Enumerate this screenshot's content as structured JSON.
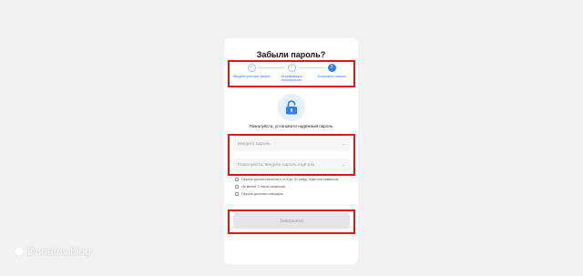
{
  "dialog": {
    "title": "Забыли пароль?",
    "subtitle": "Пожалуйста, установите надёжный пароль"
  },
  "steps": [
    {
      "label": "Введите учётную запись",
      "icon": "check-icon",
      "state": "done"
    },
    {
      "label": "Верификация безопасности",
      "icon": "check-icon",
      "state": "done"
    },
    {
      "label": "Установить пароль",
      "number": "3",
      "state": "active"
    }
  ],
  "fields": {
    "password_placeholder": "Введите пароль",
    "confirm_placeholder": "Пожалуйста, введите пароль ещё раз",
    "visibility_icon": "eye-off-icon"
  },
  "rules": [
    "Пароль должен включать от 8 до 30 цифр, букв или символов",
    "Не менее 2 типов символов",
    "Пароли должны совпадать"
  ],
  "submit_label": "Завершено",
  "watermark": "Donatov.blog",
  "colors": {
    "accent": "#2e7cf6",
    "highlight": "#d7191c",
    "disabled_button": "#e4e5e9"
  }
}
